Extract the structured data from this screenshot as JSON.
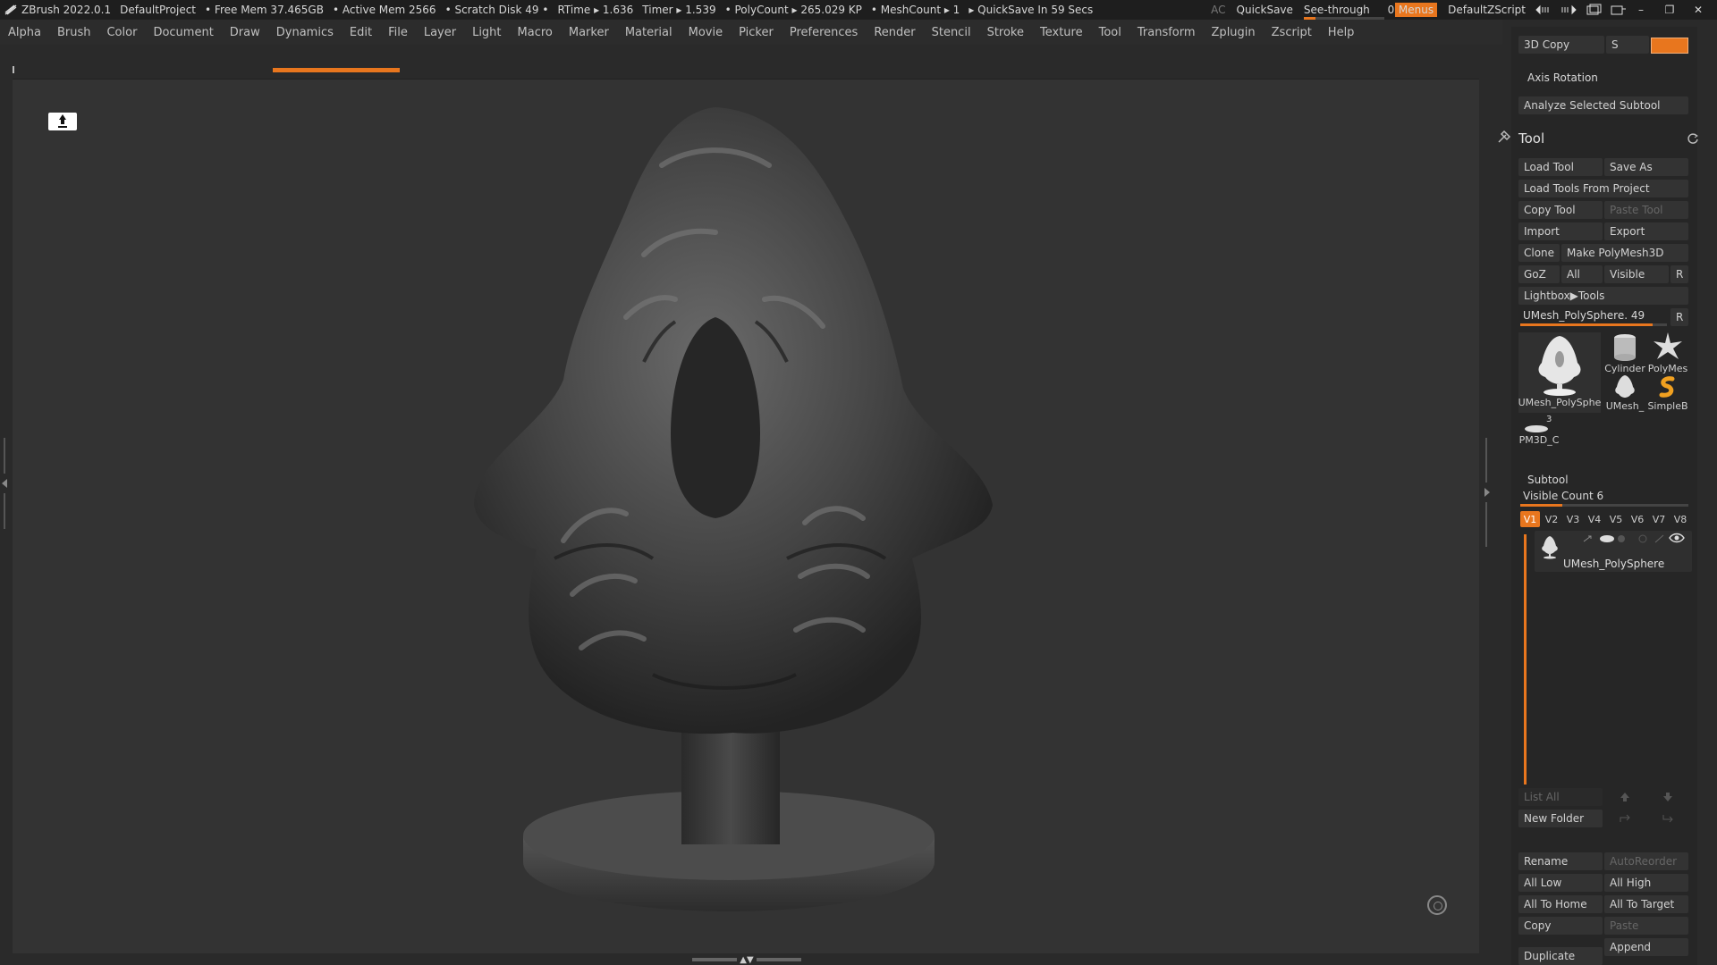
{
  "titlebar": {
    "app": "ZBrush 2022.0.1",
    "project": "DefaultProject",
    "free_mem": "• Free Mem 37.465GB",
    "active_mem": "• Active Mem 2566",
    "scratch": "• Scratch Disk 49 •",
    "rtime": "RTime ▸ 1.636",
    "timer": "Timer ▸ 1.539",
    "polycount": "• PolyCount ▸ 265.029 KP",
    "meshcount": "• MeshCount ▸ 1",
    "quicksave_in": "▸ QuickSave In 59 Secs",
    "ac": "AC",
    "quicksave": "QuickSave",
    "seethrough": "See-through",
    "seethrough_value": "0",
    "menus": "Menus",
    "script": "DefaultZScript",
    "seethrough_fill": 0.15
  },
  "menubar": [
    "Alpha",
    "Brush",
    "Color",
    "Document",
    "Draw",
    "Dynamics",
    "Edit",
    "File",
    "Layer",
    "Light",
    "Macro",
    "Marker",
    "Material",
    "Movie",
    "Picker",
    "Preferences",
    "Render",
    "Stencil",
    "Stroke",
    "Texture",
    "Tool",
    "Transform",
    "Zplugin",
    "Zscript",
    "Help"
  ],
  "panel": {
    "copy3d": "3D Copy",
    "s_label": "S",
    "axis_rotation": "Axis Rotation",
    "analyze": "Analyze Selected Subtool",
    "tool_title": "Tool",
    "load_tool": "Load Tool",
    "save_as": "Save As",
    "load_from_project": "Load Tools From Project",
    "copy_tool": "Copy Tool",
    "paste_tool": "Paste Tool",
    "import": "Import",
    "export": "Export",
    "clone": "Clone",
    "make_polymesh": "Make PolyMesh3D",
    "goz": "GoZ",
    "all": "All",
    "visible": "Visible",
    "r": "R",
    "lightbox": "Lightbox▶Tools",
    "current_tool": "UMesh_PolySphere. 49",
    "current_tool_slider": 0.9,
    "thumbs": {
      "main": "UMesh_PolySphe",
      "cylinder": "Cylinder",
      "polymesh": "PolyMes",
      "umesh": "UMesh_",
      "simpleb": "SimpleB",
      "pm3d": "PM3D_C",
      "pm3d_count": "3"
    },
    "subtool_title": "Subtool",
    "visible_count": "Visible Count 6",
    "visible_count_slider": 0.25,
    "vtabs": [
      "V1",
      "V2",
      "V3",
      "V4",
      "V5",
      "V6",
      "V7",
      "V8"
    ],
    "subtool_name": "UMesh_PolySphere",
    "list_all": "List All",
    "new_folder": "New Folder",
    "rename": "Rename",
    "auto_reorder": "AutoReorder",
    "all_low": "All Low",
    "all_high": "All High",
    "all_to_home": "All To Home",
    "all_to_target": "All To Target",
    "copy": "Copy",
    "paste": "Paste",
    "append": "Append",
    "duplicate": "Duplicate"
  },
  "canvas": {
    "progress_fill": 0.23
  }
}
